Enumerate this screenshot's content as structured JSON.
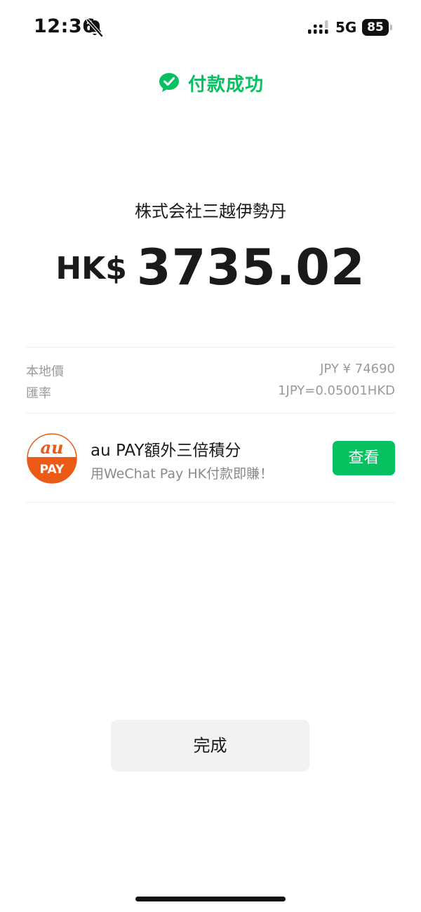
{
  "status_bar": {
    "time": "12:36",
    "network": "5G",
    "battery": "85",
    "icons": [
      "bell-slash-icon",
      "signal-icon",
      "battery-icon"
    ]
  },
  "header": {
    "icon": "wechat-pay-icon",
    "title": "付款成功",
    "accent_color": "#07c160"
  },
  "payment": {
    "merchant": "株式会社三越伊勢丹",
    "currency": "HK$",
    "amount": "3735.02"
  },
  "details": [
    {
      "label": "本地價",
      "value": "JPY ¥ 74690"
    },
    {
      "label": "匯率",
      "value": "1JPY=0.05001HKD"
    }
  ],
  "promo": {
    "logo_icon": "au-pay-logo-icon",
    "logo_text_top": "au",
    "logo_text_bottom": "PAY",
    "logo_color": "#eb5b17",
    "title": "au PAY額外三倍積分",
    "subtitle": "用WeChat Pay HK付款即賺！",
    "button_label": "查看"
  },
  "footer": {
    "done_label": "完成"
  }
}
